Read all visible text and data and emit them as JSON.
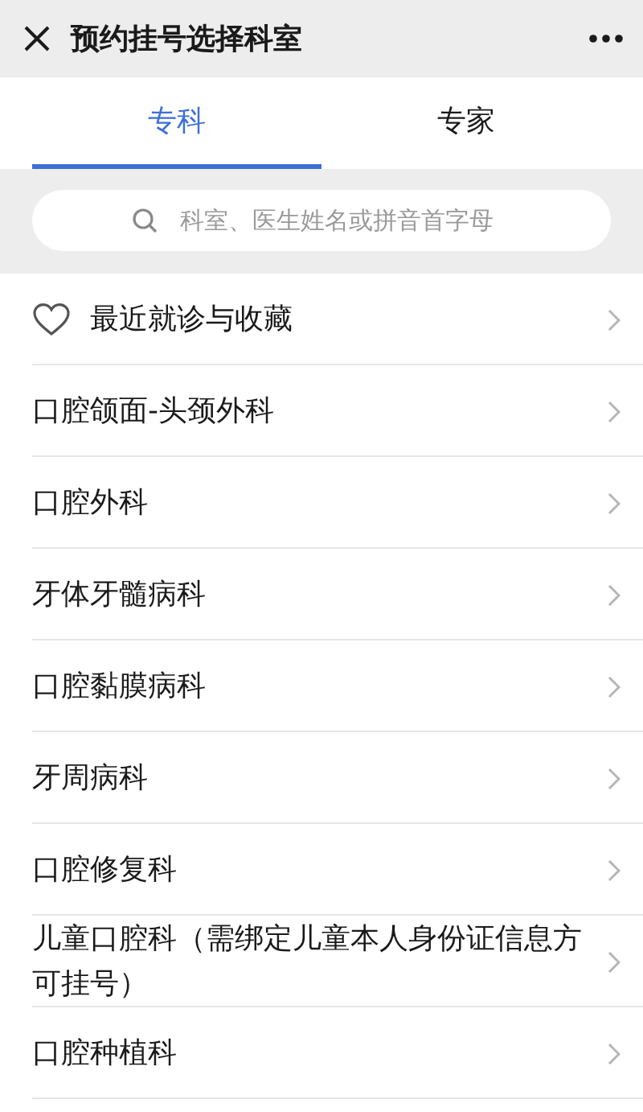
{
  "header": {
    "title": "预约挂号选择科室"
  },
  "tabs": [
    {
      "label": "专科",
      "selected": true
    },
    {
      "label": "专家",
      "selected": false
    }
  ],
  "search": {
    "placeholder": "科室、医生姓名或拼音首字母"
  },
  "departments": [
    {
      "kind": "favorite",
      "name": "最近就诊与收藏"
    },
    {
      "kind": "plain",
      "name": "口腔颌面-头颈外科"
    },
    {
      "kind": "plain",
      "name": "口腔外科"
    },
    {
      "kind": "plain",
      "name": "牙体牙髓病科"
    },
    {
      "kind": "plain",
      "name": "口腔黏膜病科"
    },
    {
      "kind": "plain",
      "name": "牙周病科"
    },
    {
      "kind": "plain",
      "name": "口腔修复科"
    },
    {
      "kind": "plain",
      "name": "儿童口腔科（需绑定儿童本人身份证信息方可挂号）"
    },
    {
      "kind": "plain",
      "name": "口腔种植科"
    }
  ]
}
